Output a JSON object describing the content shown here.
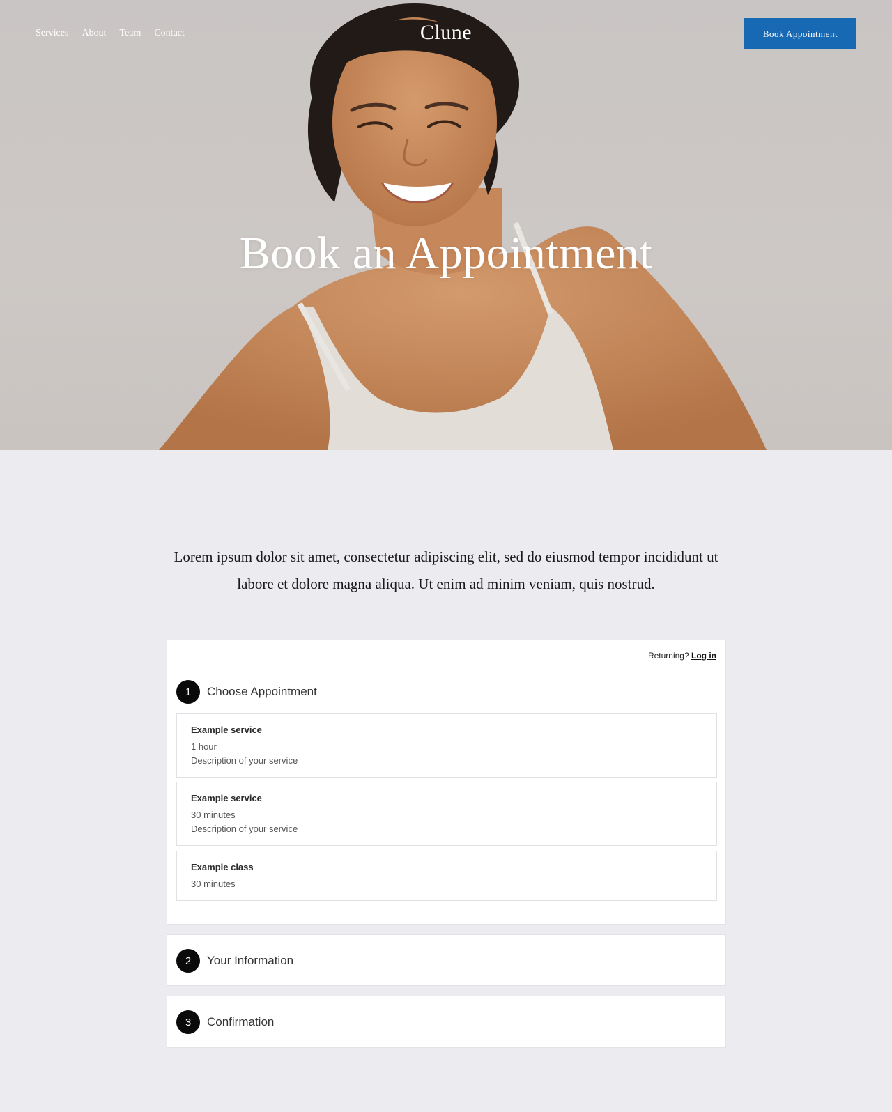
{
  "header": {
    "nav": [
      "Services",
      "About",
      "Team",
      "Contact"
    ],
    "logo": "Clune",
    "book_button": "Book Appointment"
  },
  "hero": {
    "title": "Book an Appointment"
  },
  "intro": {
    "text": "Lorem ipsum dolor sit amet, consectetur adipiscing elit, sed do eiusmod tempor incididunt ut labore et dolore magna aliqua. Ut enim ad minim veniam, quis nostrud."
  },
  "scheduler": {
    "returning_label": "Returning?",
    "login_link": "Log in",
    "steps": [
      {
        "number": "1",
        "title": "Choose Appointment"
      },
      {
        "number": "2",
        "title": "Your Information"
      },
      {
        "number": "3",
        "title": "Confirmation"
      }
    ],
    "services": [
      {
        "name": "Example service",
        "duration": "1 hour",
        "description": "Description of your service"
      },
      {
        "name": "Example service",
        "duration": "30 minutes",
        "description": "Description of your service"
      },
      {
        "name": "Example class",
        "duration": "30 minutes"
      }
    ]
  },
  "colors": {
    "accent": "#1769b4",
    "page_background": "#ecebef",
    "step_badge": "#0a0a0a"
  }
}
